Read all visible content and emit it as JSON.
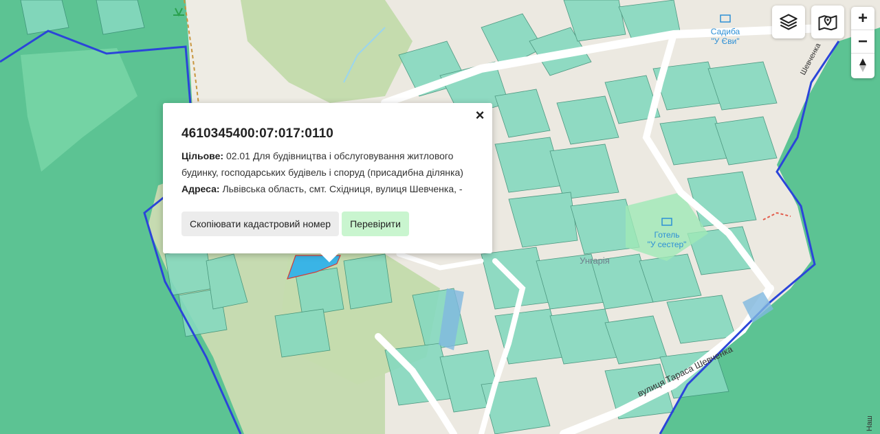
{
  "map": {
    "labels": {
      "sadyba_name": "Садиба",
      "sadyba_sub": "\"У Єви\"",
      "hotel_name": "Готель",
      "hotel_sub": "\"У сестер\"",
      "area_name": "Унгарія",
      "street_name": "вулиця Тараса Шевченка",
      "street_right": "Шевченка",
      "street_edge": "Наш"
    },
    "colors": {
      "forest": "#5fc495",
      "parcel": "#86d9bf",
      "park": "#c5dcb0",
      "road": "#ffffff",
      "boundary": "#2b45d9",
      "selected": "#3ab4e6"
    }
  },
  "controls": {
    "layers_icon": "layers-icon",
    "map_icon": "map-pin-icon",
    "zoom_in": "+",
    "zoom_out": "−",
    "compass": "compass-icon"
  },
  "popup": {
    "cadastral_number": "4610345400:07:017:0110",
    "purpose_label": "Цільове:",
    "purpose_value_1": "02.01 Для будівництва і обслуговування житлового",
    "purpose_value_2": "будинку, господарських будівель і споруд (присадибна ділянка)",
    "address_label": "Адреса:",
    "address_value": "Львівська область, смт. Східниця, вулиця Шевченка, -",
    "copy_label": "Скопіювати кадастровий номер",
    "check_label": "Перевірити",
    "close_label": "×"
  }
}
